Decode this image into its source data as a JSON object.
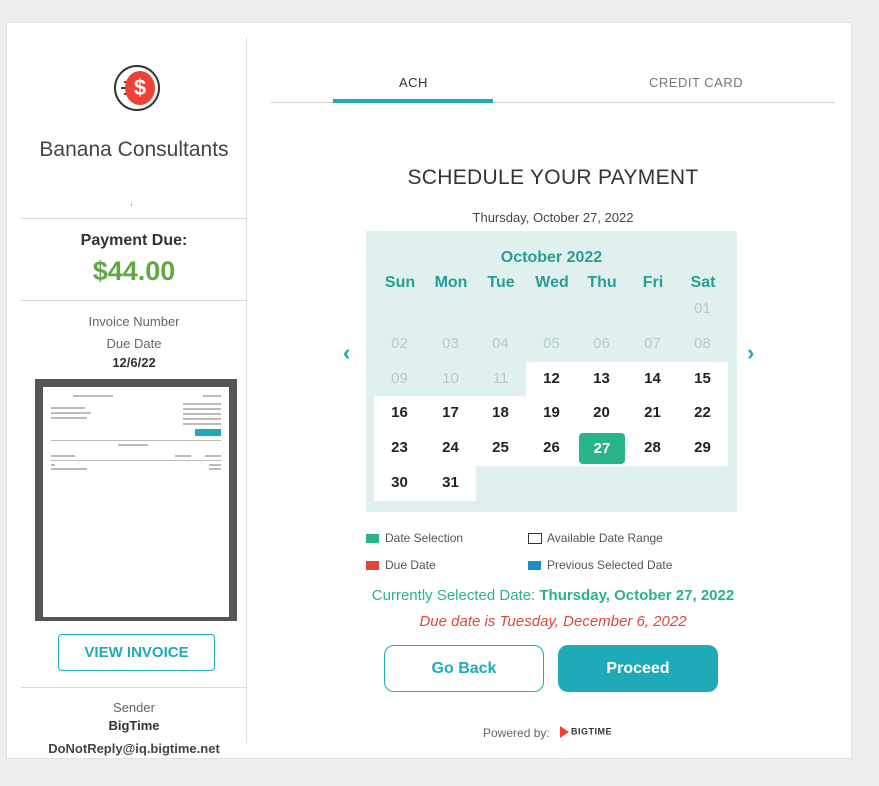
{
  "company": {
    "name": "Banana Consultants",
    "subtitle": ","
  },
  "payment": {
    "label": "Payment Due:",
    "amount": "$44.00"
  },
  "invoice": {
    "number_label": "Invoice Number",
    "due_date_label": "Due Date",
    "due_date": "12/6/22",
    "view_label": "VIEW INVOICE"
  },
  "sender": {
    "label": "Sender",
    "name": "BigTime",
    "email": "DoNotReply@iq.bigtime.net"
  },
  "tabs": [
    {
      "label": "ACH"
    },
    {
      "label": "CREDIT CARD"
    }
  ],
  "schedule": {
    "title": "SCHEDULE YOUR PAYMENT",
    "selected_long": "Thursday, October 27, 2022"
  },
  "calendar": {
    "month_label": "October 2022",
    "days_of_week": [
      "Sun",
      "Mon",
      "Tue",
      "Wed",
      "Thu",
      "Fri",
      "Sat"
    ],
    "weeks": [
      [
        "",
        "",
        "",
        "",
        "",
        "",
        "01"
      ],
      [
        "02",
        "03",
        "04",
        "05",
        "06",
        "07",
        "08"
      ],
      [
        "09",
        "10",
        "11",
        "12",
        "13",
        "14",
        "15"
      ],
      [
        "16",
        "17",
        "18",
        "19",
        "20",
        "21",
        "22"
      ],
      [
        "23",
        "24",
        "25",
        "26",
        "27",
        "28",
        "29"
      ],
      [
        "30",
        "31",
        "",
        "",
        "",
        "",
        ""
      ]
    ],
    "selected_day": "27",
    "prev_icon": "‹",
    "next_icon": "›"
  },
  "legend": {
    "date_selection": "Date Selection",
    "available_range": "Available Date Range",
    "due_date": "Due Date",
    "previous_selected": "Previous Selected Date"
  },
  "colors": {
    "selection": "#28b48a",
    "due": "#e2453a",
    "previous": "#1a8fc7",
    "accent": "#1eaab7",
    "amount": "#62a745"
  },
  "status": {
    "current_prefix": "Currently Selected Date:",
    "current_value": "Thursday, October 27, 2022",
    "due_message": "Due date is Tuesday, December 6, 2022"
  },
  "actions": {
    "back_label": "Go Back",
    "proceed_label": "Proceed"
  },
  "footer": {
    "powered_by": "Powered by:",
    "brand": "BIGTIME"
  }
}
